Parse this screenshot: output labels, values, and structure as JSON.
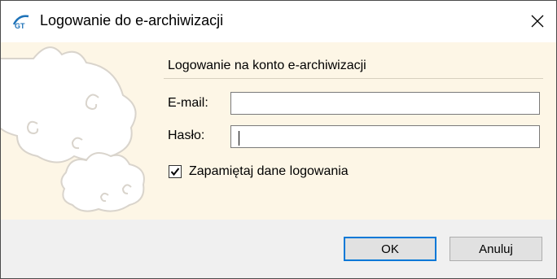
{
  "window": {
    "title": "Logowanie do e-archiwizacji"
  },
  "form": {
    "group_title": "Logowanie na konto e-archiwizacji",
    "email_label": "E-mail:",
    "email_value": "",
    "password_label": "Hasło:",
    "password_value": "",
    "remember_label": "Zapamiętaj dane logowania",
    "remember_checked": true
  },
  "buttons": {
    "ok_label": "OK",
    "cancel_label": "Anuluj"
  },
  "colors": {
    "content_bg": "#fdf6e6",
    "footer_bg": "#f0f0f0",
    "default_button_border": "#0078d7",
    "cloud_stroke": "#d9d4cc"
  },
  "icons": {
    "app": "gt-logo-icon",
    "close": "close-icon",
    "check": "checkmark-icon"
  }
}
